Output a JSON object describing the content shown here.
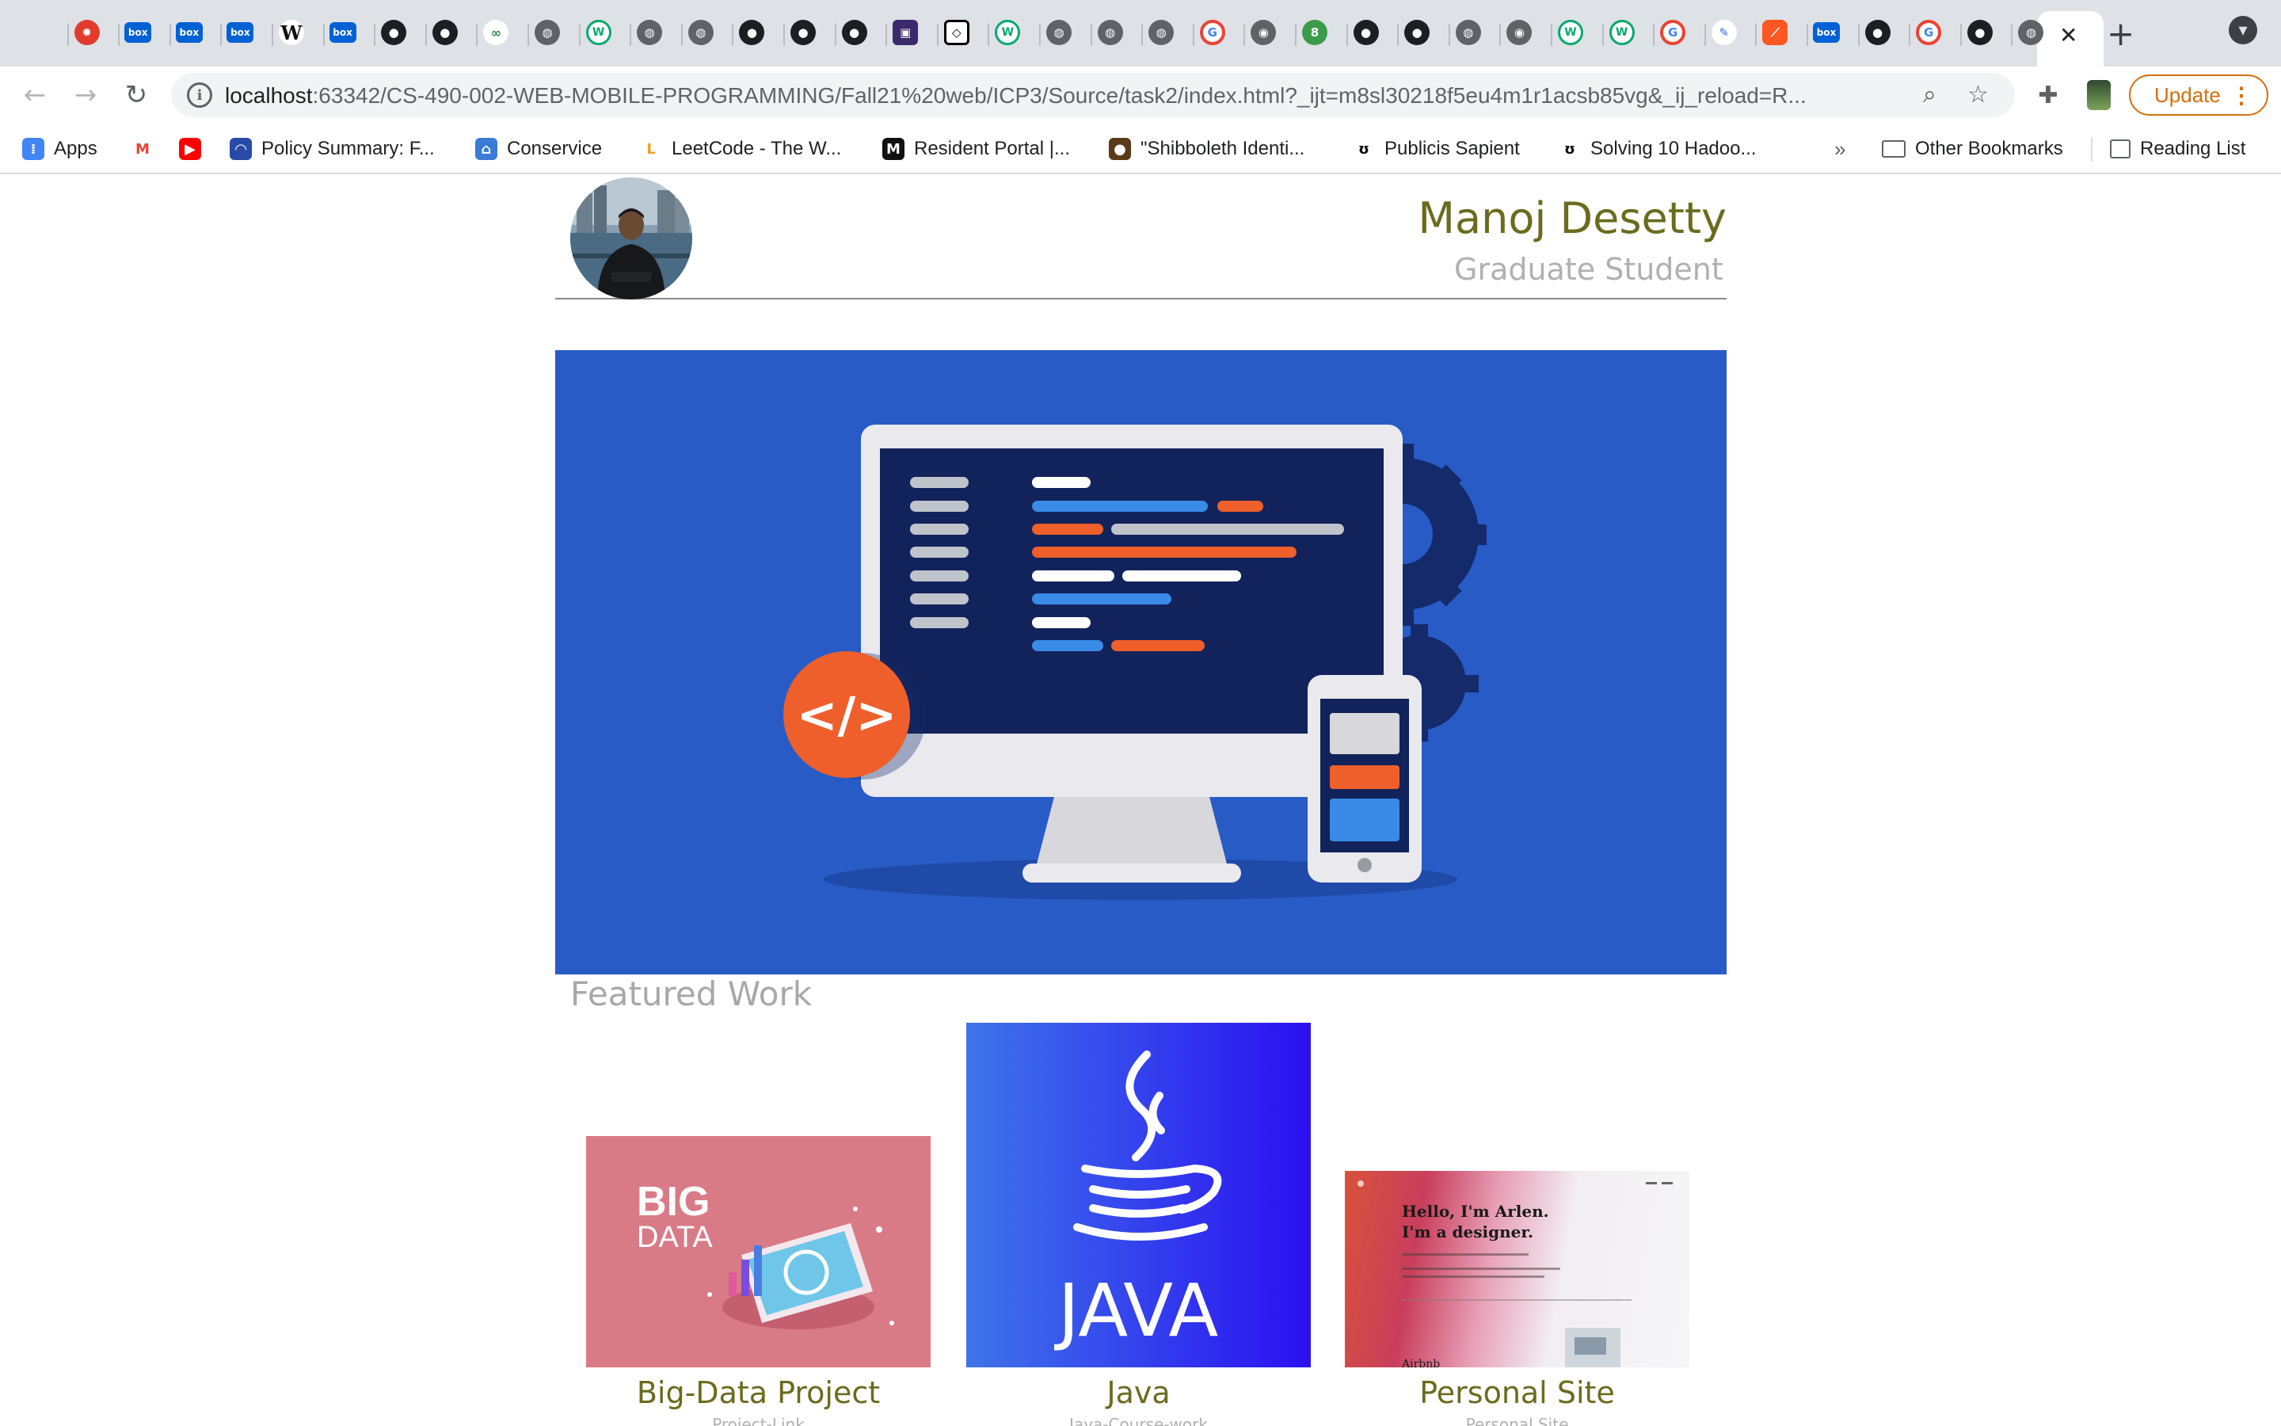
{
  "browser": {
    "tabs": [
      {
        "icon": "apple-icon",
        "glyph": ""
      },
      {
        "icon": "maltese-cross-icon",
        "glyph": "✹"
      },
      {
        "icon": "box-icon",
        "glyph": "box"
      },
      {
        "icon": "box-icon",
        "glyph": "box"
      },
      {
        "icon": "box-icon",
        "glyph": "box"
      },
      {
        "icon": "wikipedia-icon",
        "glyph": "W"
      },
      {
        "icon": "box-icon",
        "glyph": "box"
      },
      {
        "icon": "github-icon",
        "glyph": "●"
      },
      {
        "icon": "github-icon",
        "glyph": "●"
      },
      {
        "icon": "geeksforgeeks-icon",
        "glyph": "∞"
      },
      {
        "icon": "globe-icon",
        "glyph": "◍"
      },
      {
        "icon": "w3schools-icon",
        "glyph": "W"
      },
      {
        "icon": "globe-icon",
        "glyph": "◍"
      },
      {
        "icon": "globe-icon",
        "glyph": "◍"
      },
      {
        "icon": "github-icon",
        "glyph": "●"
      },
      {
        "icon": "github-icon",
        "glyph": "●"
      },
      {
        "icon": "github-icon",
        "glyph": "●"
      },
      {
        "icon": "app-icon",
        "glyph": "▣"
      },
      {
        "icon": "codepen-icon",
        "glyph": "◇"
      },
      {
        "icon": "w3schools-icon",
        "glyph": "W"
      },
      {
        "icon": "globe-icon",
        "glyph": "◍"
      },
      {
        "icon": "globe-icon",
        "glyph": "◍"
      },
      {
        "icon": "globe-icon",
        "glyph": "◍"
      },
      {
        "icon": "google-icon",
        "glyph": "G"
      },
      {
        "icon": "chrome-icon",
        "glyph": "◉"
      },
      {
        "icon": "green-circle-icon",
        "glyph": "8"
      },
      {
        "icon": "github-icon",
        "glyph": "●"
      },
      {
        "icon": "github-icon",
        "glyph": "●"
      },
      {
        "icon": "globe-icon",
        "glyph": "◍"
      },
      {
        "icon": "chrome-icon",
        "glyph": "◉"
      },
      {
        "icon": "w3schools-icon",
        "glyph": "W"
      },
      {
        "icon": "w3schools-icon",
        "glyph": "W"
      },
      {
        "icon": "google-icon",
        "glyph": "G"
      },
      {
        "icon": "pen-icon",
        "glyph": "✎"
      },
      {
        "icon": "orange-app-icon",
        "glyph": "⟋"
      },
      {
        "icon": "box-icon",
        "glyph": "box"
      },
      {
        "icon": "github-icon",
        "glyph": "●"
      },
      {
        "icon": "google-icon",
        "glyph": "G"
      },
      {
        "icon": "github-icon",
        "glyph": "●"
      },
      {
        "icon": "globe-icon",
        "glyph": "◍"
      }
    ],
    "active_tab_close": "✕",
    "new_tab": "+",
    "tab_menu": "▾",
    "back": "←",
    "forward": "→",
    "reload": "↻",
    "url_host": "localhost",
    "url_rest": ":63342/CS-490-002-WEB-MOBILE-PROGRAMMING/Fall21%20web/ICP3/Source/task2/index.html?_ijt=m8sl30218f5eu4m1r1acsb85vg&_ij_reload=R...",
    "update_label": "Update",
    "bookmarks": [
      {
        "label": "Apps",
        "icon": "apps-grid-icon",
        "color": "#4285f4"
      },
      {
        "label": "",
        "icon": "gmail-icon",
        "color": "#ea4335"
      },
      {
        "label": "",
        "icon": "youtube-icon",
        "color": "#ff0000"
      },
      {
        "label": "Policy Summary: F...",
        "icon": "policy-icon",
        "color": "#2a4aa8"
      },
      {
        "label": "Conservice",
        "icon": "house-icon",
        "color": "#3a7bd5"
      },
      {
        "label": "LeetCode - The W...",
        "icon": "leetcode-icon",
        "color": "#f89f1b"
      },
      {
        "label": "Resident Portal |...",
        "icon": "resident-portal-icon",
        "color": "#111111"
      },
      {
        "label": "\"Shibboleth Identi...",
        "icon": "shibboleth-icon",
        "color": "#5b3a1a"
      },
      {
        "label": "Publicis Sapient",
        "icon": "sapient-icon",
        "color": "#111111"
      },
      {
        "label": "Solving 10 Hadoo...",
        "icon": "sapient-icon",
        "color": "#111111"
      }
    ],
    "bookmarks_more": "»",
    "other_bookmarks": "Other Bookmarks",
    "reading_list": "Reading List"
  },
  "page": {
    "name": "Manoj Desetty",
    "role": "Graduate Student",
    "featured_title": "Featured Work",
    "projects": [
      {
        "title": "Big-Data Project",
        "link": "Project-Link",
        "banner": [
          "BIG",
          "DATA"
        ]
      },
      {
        "title": "Java",
        "link": "Java-Course-work",
        "banner": [
          "JAVA"
        ]
      },
      {
        "title": "Personal Site",
        "link": "Personal Site",
        "banner": [
          "Hello, I'm Arlen.",
          "I'm a designer.",
          "Airbnb"
        ]
      }
    ],
    "hero_code_symbol": "</>"
  },
  "colors": {
    "accent_olive": "#6b6b1e",
    "muted_gray": "#b0b0b0",
    "hero_blue": "#285bc6",
    "update_orange": "#d56e0c"
  }
}
